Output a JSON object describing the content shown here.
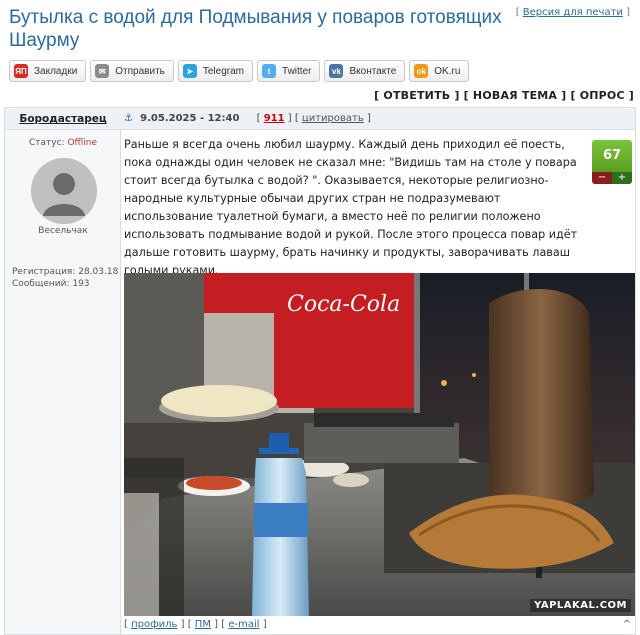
{
  "page_title": "Бутылка с водой для Подмывания у поваров готовящих Шаурму",
  "print_version": {
    "bracket_open": "[",
    "label": "Версия для печати",
    "bracket_close": "]"
  },
  "share_buttons": [
    {
      "label": "Закладки",
      "icon": "yandex-icon",
      "icon_text": "ЯП",
      "color": "#d62d20"
    },
    {
      "label": "Отправить",
      "icon": "mail-icon",
      "icon_text": "✉",
      "color": "#8a8a8a"
    },
    {
      "label": "Telegram",
      "icon": "telegram-icon",
      "icon_text": "➤",
      "color": "#2aa3de"
    },
    {
      "label": "Twitter",
      "icon": "twitter-icon",
      "icon_text": "t",
      "color": "#55acee"
    },
    {
      "label": "Вконтакте",
      "icon": "vk-icon",
      "icon_text": "vk",
      "color": "#4c75a3"
    },
    {
      "label": "OK.ru",
      "icon": "ok-icon",
      "icon_text": "ok",
      "color": "#f29718"
    }
  ],
  "actions": {
    "reply": "[ ОТВЕТИТЬ ]",
    "new_topic": "[ НОВАЯ ТЕМА ]",
    "poll": "[ ОПРОС ]"
  },
  "post": {
    "author": "Бородастарец",
    "date": "9.05.2025 - 12:40",
    "number": "911",
    "quote_label": "цитировать",
    "status_label": "Статус:",
    "status_value": "Offline",
    "rank": "Весельчак",
    "registration": "Регистрация: 28.03.18",
    "messages": "Сообщений: 193",
    "rating": "67",
    "rating_minus": "−",
    "rating_plus": "+",
    "text": "Раньше я всегда очень любил шаурму. Каждый день приходил её поесть, пока однажды один человек не сказал мне: \"Видишь там на столе у повара стоит всегда бутылка с водой? \". Оказывается, некоторые религиозно-народные культурные обычаи других стран не подразумевают использование туалетной бумаги, а вместо неё по религии положено использовать подмывание водой и рукой. После этого процесса повар идёт дальше готовить шаурму, брать начинку и продукты, заворачивать лаваш голыми руками.",
    "image_watermark": "YAPLAKAL.COM",
    "image_sign": "Coca-Cola",
    "footer": {
      "profile": "профиль",
      "pm": "ПМ",
      "email": "e-mail",
      "up": "^"
    }
  },
  "colors": {
    "accent": "#2b6aa0",
    "offline": "#c0392b",
    "rating_green": "#6cb82e"
  }
}
